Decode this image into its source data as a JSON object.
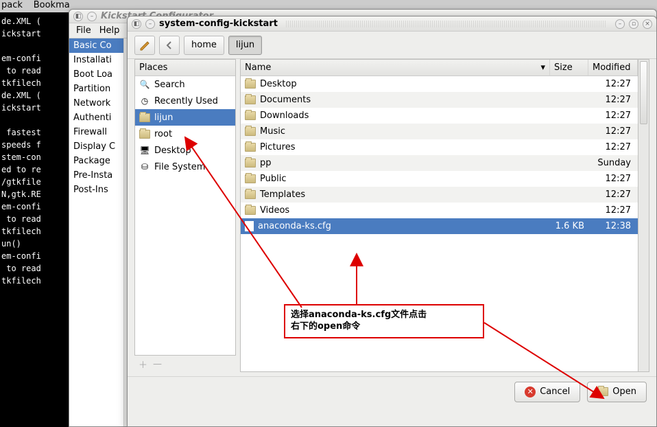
{
  "taskbar": {
    "back": "pack",
    "bookmarks": "Bookma"
  },
  "terminal_text": "de.XML (\nickstart\n\nem-confi\n to read\ntkfilech\nde.XML (\nickstart\n\n fastest\nspeeds f\nstem-con\ned to re\n/gtkfile\nN,gtk.RE\nem-confi\n to read\ntkfilech\nun()\nem-confi\n to read\ntkfilech",
  "kick": {
    "title": "Kickstart Configurator",
    "menu_file": "File",
    "menu_help": "Help",
    "sidebar": [
      "Basic Co",
      "Installati",
      "Boot Loa",
      "Partition",
      "Network",
      "Authenti",
      "Firewall",
      "Display C",
      "Package",
      "Pre-Insta",
      "Post-Ins"
    ]
  },
  "dialog": {
    "title": "system-config-kickstart",
    "path": {
      "home": "home",
      "lijun": "lijun"
    },
    "places_header": "Places",
    "places": [
      {
        "icon": "search-icon",
        "label": "Search"
      },
      {
        "icon": "clock-icon",
        "label": "Recently Used"
      },
      {
        "icon": "folder-icon",
        "label": "lijun",
        "selected": true
      },
      {
        "icon": "folder-icon",
        "label": "root"
      },
      {
        "icon": "desktop-icon",
        "label": "Desktop"
      },
      {
        "icon": "drive-icon",
        "label": "File System"
      }
    ],
    "cols": {
      "name": "Name",
      "size": "Size",
      "modified": "Modified"
    },
    "files": [
      {
        "type": "folder",
        "name": "Desktop",
        "size": "",
        "mod": "12:27"
      },
      {
        "type": "folder",
        "name": "Documents",
        "size": "",
        "mod": "12:27"
      },
      {
        "type": "folder",
        "name": "Downloads",
        "size": "",
        "mod": "12:27"
      },
      {
        "type": "folder",
        "name": "Music",
        "size": "",
        "mod": "12:27"
      },
      {
        "type": "folder",
        "name": "Pictures",
        "size": "",
        "mod": "12:27"
      },
      {
        "type": "folder",
        "name": "pp",
        "size": "",
        "mod": "Sunday"
      },
      {
        "type": "folder",
        "name": "Public",
        "size": "",
        "mod": "12:27"
      },
      {
        "type": "folder",
        "name": "Templates",
        "size": "",
        "mod": "12:27"
      },
      {
        "type": "folder",
        "name": "Videos",
        "size": "",
        "mod": "12:27"
      },
      {
        "type": "file",
        "name": "anaconda-ks.cfg",
        "size": "1.6 KB",
        "mod": "12:38",
        "selected": true
      }
    ],
    "buttons": {
      "cancel": "Cancel",
      "open": "Open"
    }
  },
  "annotation": {
    "line1": "选择anaconda-ks.cfg文件点击",
    "line2": "右下的open命令"
  }
}
